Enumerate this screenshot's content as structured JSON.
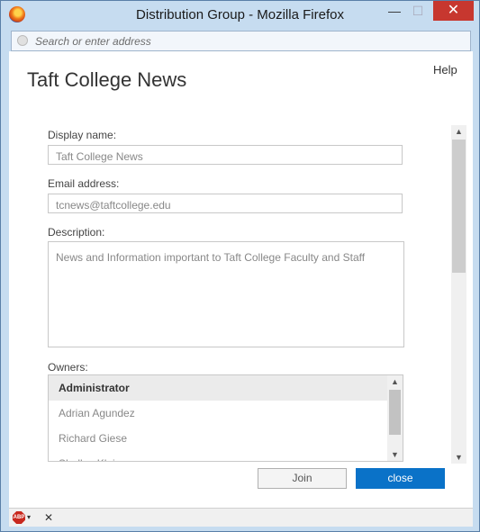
{
  "window": {
    "title": "Distribution Group - Mozilla Firefox",
    "minimize_glyph": "—",
    "maximize_glyph": "☐",
    "close_glyph": "✕"
  },
  "addressbar": {
    "placeholder": "Search or enter address"
  },
  "page": {
    "title": "Taft College News",
    "help": "Help"
  },
  "form": {
    "display_name_label": "Display name:",
    "display_name_value": "Taft College News",
    "email_label": "Email address:",
    "email_value": "tcnews@taftcollege.edu",
    "description_label": "Description:",
    "description_value": "News and Information important to Taft College Faculty and Staff",
    "owners_label": "Owners:",
    "owners": [
      "Administrator",
      "Adrian Agundez",
      "Richard Giese",
      "Shelley Klein"
    ]
  },
  "buttons": {
    "join": "Join",
    "close": "close"
  },
  "statusbar": {
    "abp_label": "ABP",
    "dropdown_glyph": "▾",
    "close_glyph": "✕"
  },
  "colors": {
    "primary_button": "#0a72c8",
    "window_close": "#c7372f",
    "frame": "#c6dcf0"
  }
}
